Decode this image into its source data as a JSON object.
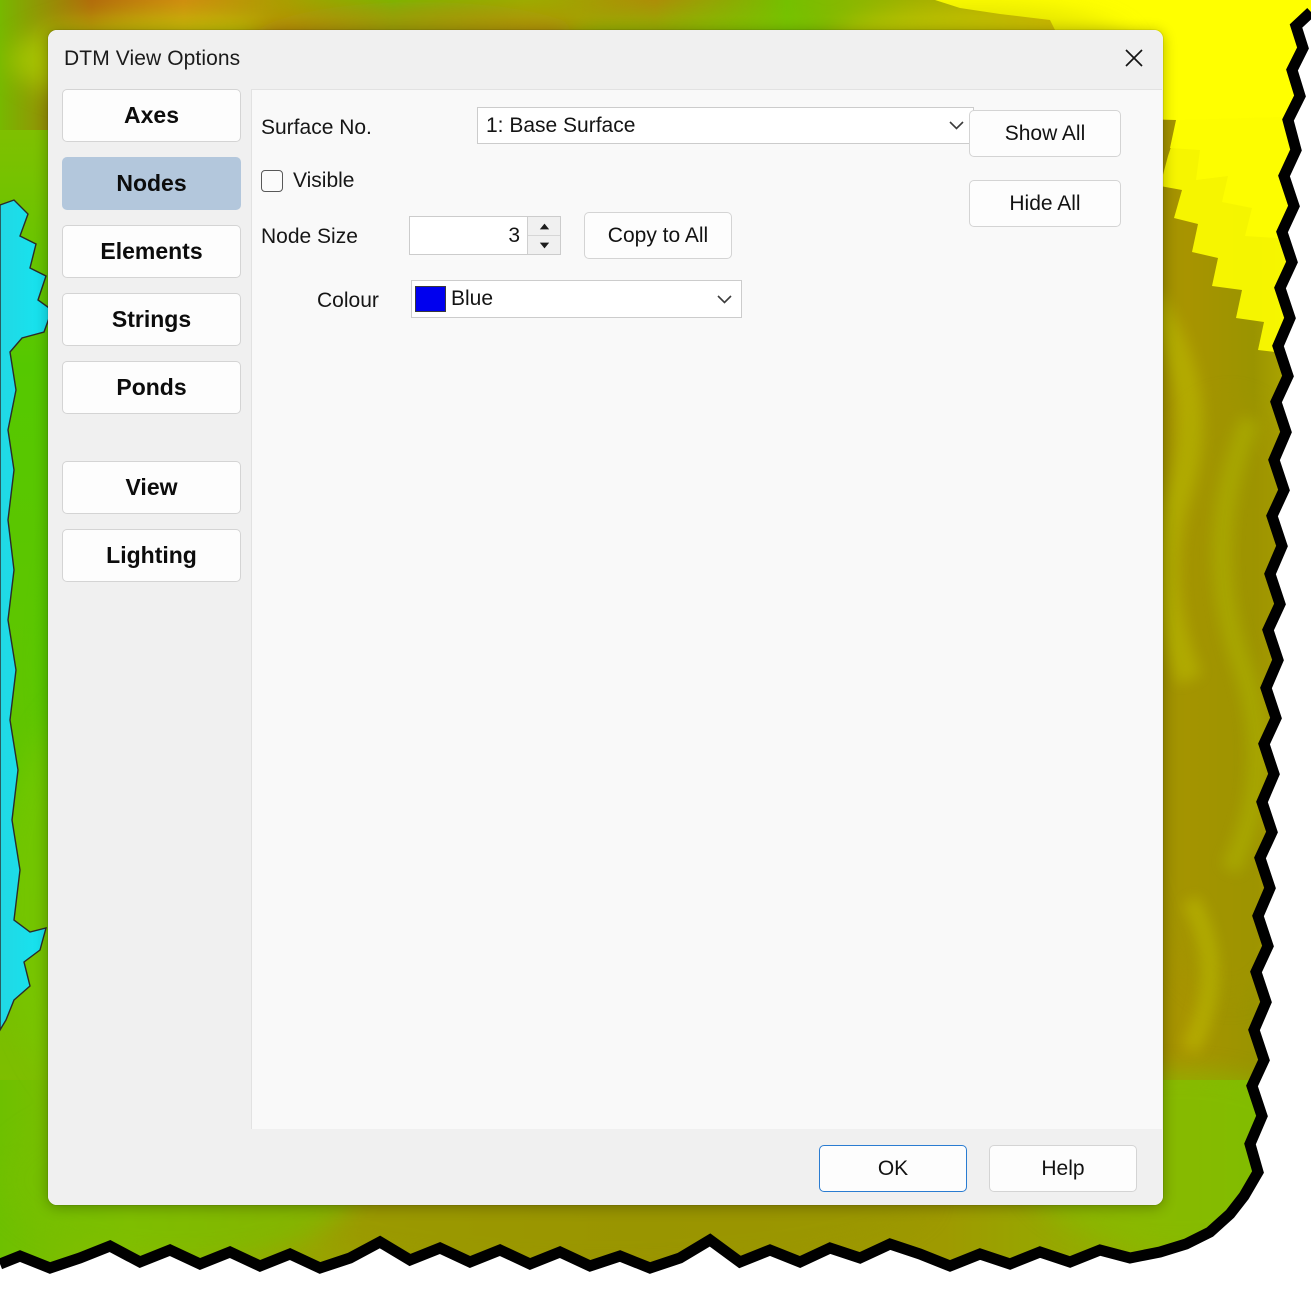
{
  "dialog": {
    "title": "DTM View Options",
    "close_icon": "close-icon"
  },
  "sidebar": {
    "items": [
      {
        "label": "Axes",
        "selected": false
      },
      {
        "label": "Nodes",
        "selected": true
      },
      {
        "label": "Elements",
        "selected": false
      },
      {
        "label": "Strings",
        "selected": false
      },
      {
        "label": "Ponds",
        "selected": false
      },
      {
        "label": "View",
        "selected": false
      },
      {
        "label": "Lighting",
        "selected": false
      }
    ]
  },
  "content": {
    "surface": {
      "label": "Surface No.",
      "value": "1: Base Surface",
      "chevron_icon": "chevron-down-icon"
    },
    "visible": {
      "label": "Visible",
      "checked": false
    },
    "node_size": {
      "label": "Node Size",
      "value": "3",
      "up_icon": "triangle-up-icon",
      "down_icon": "triangle-down-icon"
    },
    "copy_to_all": {
      "label": "Copy to All"
    },
    "colour": {
      "label": "Colour",
      "value": "Blue",
      "swatch_hex": "#0000ee",
      "chevron_icon": "chevron-down-icon"
    },
    "show_all": {
      "label": "Show All"
    },
    "hide_all": {
      "label": "Hide All"
    }
  },
  "footer": {
    "ok": {
      "label": "OK"
    },
    "help": {
      "label": "Help"
    }
  },
  "background": {
    "description": "DTM terrain surface render",
    "colors": {
      "water": "#18e0ee",
      "low_green": "#3fc400",
      "mid_green": "#86c400",
      "olive": "#998c00",
      "yellow": "#ffff00",
      "orange": "#c06a10",
      "edge": "#000000",
      "page": "#ffffff"
    }
  }
}
